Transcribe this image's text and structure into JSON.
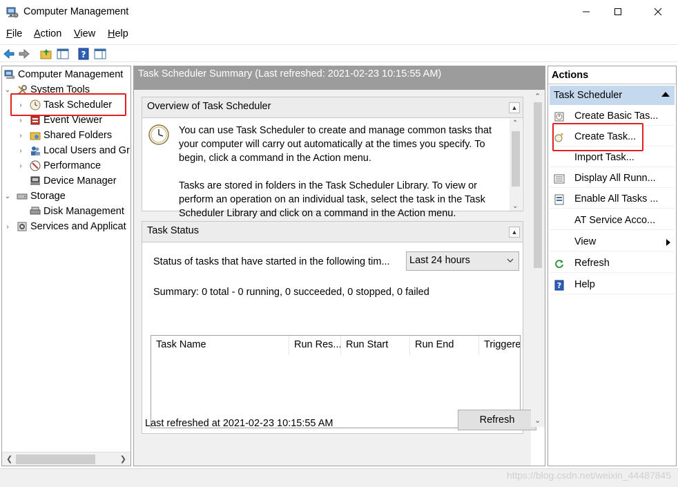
{
  "window": {
    "title": "Computer Management",
    "icons": {
      "app": "computer-management-icon",
      "minimize": "minimize-icon",
      "maximize": "maximize-icon",
      "close": "close-icon"
    }
  },
  "menu": {
    "items": [
      {
        "first": "F",
        "rest": "ile"
      },
      {
        "first": "A",
        "rest": "ction"
      },
      {
        "first": "V",
        "rest": "iew"
      },
      {
        "first": "H",
        "rest": "elp"
      }
    ]
  },
  "toolbar": {
    "buttons": [
      "back-icon",
      "forward-icon",
      "up-folder-icon",
      "show-hide-console-tree-icon",
      "help-icon",
      "show-hide-action-pane-icon"
    ]
  },
  "tree": {
    "items": [
      {
        "label": "Computer Management",
        "icon": "computer-management-icon"
      },
      {
        "label": "System Tools",
        "icon": "system-tools-icon"
      },
      {
        "label": "Task Scheduler",
        "icon": "clock-icon"
      },
      {
        "label": "Event Viewer",
        "icon": "event-viewer-icon"
      },
      {
        "label": "Shared Folders",
        "icon": "shared-folders-icon"
      },
      {
        "label": "Local Users and Gr",
        "icon": "users-icon"
      },
      {
        "label": "Performance",
        "icon": "performance-icon"
      },
      {
        "label": "Device Manager",
        "icon": "device-manager-icon"
      },
      {
        "label": "Storage",
        "icon": "storage-icon"
      },
      {
        "label": "Disk Management",
        "icon": "disk-management-icon"
      },
      {
        "label": "Services and Applicat",
        "icon": "services-icon"
      }
    ]
  },
  "center": {
    "header": "Task Scheduler Summary (Last refreshed: 2021-02-23 10:15:55 AM)",
    "overview": {
      "title": "Overview of Task Scheduler",
      "para1": "You can use Task Scheduler to create and manage common tasks that your computer will carry out automatically at the times you specify. To begin, click a command in the Action menu.",
      "para2": "Tasks are stored in folders in the Task Scheduler Library. To view or perform an operation on an individual task, select the task in the Task Scheduler Library and click on a command in the Action menu."
    },
    "status": {
      "title": "Task Status",
      "filter_label": "Status of tasks that have started in the following tim...",
      "filter_value": "Last 24 hours",
      "summary": "Summary: 0 total - 0 running, 0 succeeded, 0 stopped, 0 failed",
      "columns": [
        "Task Name",
        "Run Res...",
        "Run Start",
        "Run End",
        "Triggere"
      ]
    },
    "footer": {
      "last_refreshed": "Last refreshed at 2021-02-23 10:15:55 AM",
      "refresh_label": "Refresh"
    }
  },
  "actions": {
    "title": "Actions",
    "group": "Task Scheduler",
    "items": [
      {
        "label": "Create Basic Tas...",
        "icon": "create-basic-task-icon"
      },
      {
        "label": "Create Task...",
        "icon": "create-task-icon"
      },
      {
        "label": "Import Task...",
        "icon": ""
      },
      {
        "label": "Display All Runn...",
        "icon": "display-running-tasks-icon"
      },
      {
        "label": "Enable All Tasks ...",
        "icon": "enable-history-icon"
      },
      {
        "label": "AT Service Acco...",
        "icon": ""
      },
      {
        "label": "View",
        "icon": ""
      },
      {
        "label": "Refresh",
        "icon": "refresh-icon"
      },
      {
        "label": "Help",
        "icon": "help-icon"
      }
    ]
  },
  "watermark": "https://blog.csdn.net/weixin_44487845",
  "colors": {
    "highlight_box": "#e02020",
    "actions_group_bg": "#c5d9ee",
    "center_header_bg": "#9c9c9c"
  }
}
